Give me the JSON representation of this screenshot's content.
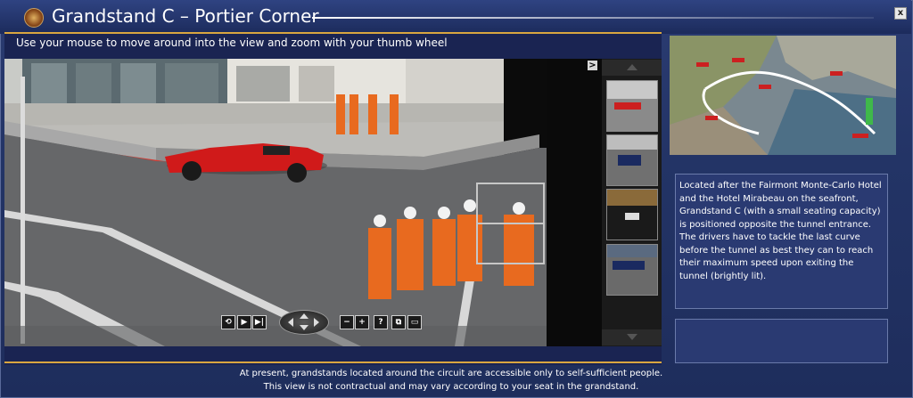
{
  "window": {
    "title": "Grandstand C – Portier Corner",
    "close_label": "x"
  },
  "viewer": {
    "instructions": "Use your mouse to move around into the view and zoom with your thumb wheel",
    "collapse_label": ">",
    "controls": {
      "back": "⟲",
      "play": "▶",
      "next": "▶|",
      "zoom_out": "−",
      "zoom_in": "+",
      "help": "?",
      "fullscreen": "⧉",
      "window": "▭"
    }
  },
  "description": "Located after the Fairmont Monte-Carlo Hotel and the Hotel Mirabeau on the seafront, Grandstand C (with a small seating capacity) is positioned opposite the tunnel entrance. The drivers have to tackle the last curve before the tunnel as best they can to reach their maximum speed upon exiting the tunnel (brightly lit).",
  "footer": {
    "line1": "At present, grandstands located around the circuit are accessible only to self-sufficient people.",
    "line2": "This view is not contractual and may vary according to your seat in the grandstand."
  },
  "colors": {
    "frame": "#233466",
    "accent": "#d9a640",
    "text": "#ffffff"
  }
}
